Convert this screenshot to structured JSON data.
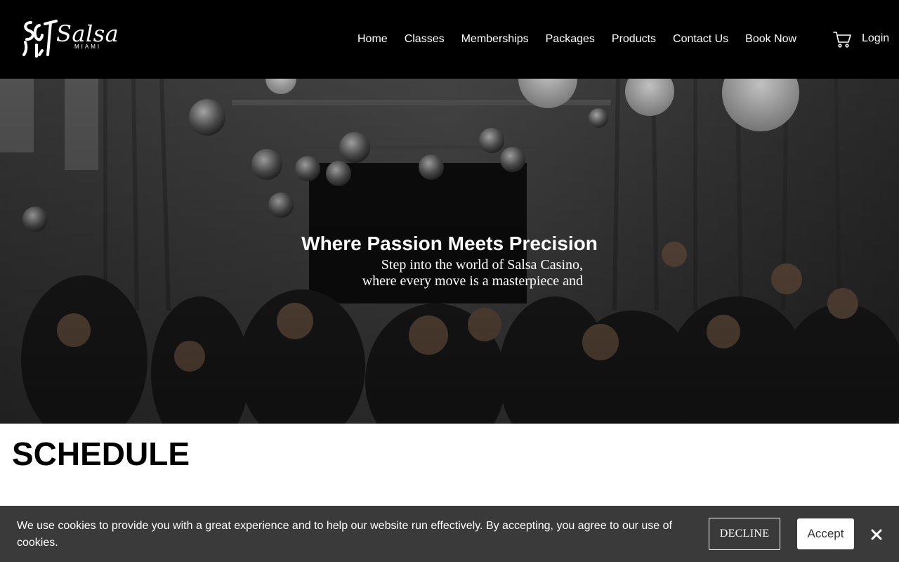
{
  "logo": {
    "mark_alt": "SCT",
    "word": "Salsa",
    "sub": "MIAMI"
  },
  "nav": {
    "items": [
      {
        "label": "Home"
      },
      {
        "label": "Classes"
      },
      {
        "label": "Memberships"
      },
      {
        "label": "Packages"
      },
      {
        "label": "Products"
      },
      {
        "label": "Contact Us"
      },
      {
        "label": "Book Now"
      }
    ],
    "cart_icon": "cart-icon",
    "login_label": "Login"
  },
  "hero": {
    "title": "Where Passion Meets Precision",
    "subtitle_line1": "Step into the world of Salsa Casino,",
    "subtitle_line2": "where every move is a masterpiece and"
  },
  "schedule": {
    "title": "SCHEDULE"
  },
  "cookie": {
    "text": "We use cookies to provide you with a great experience and to help our website run effectively. By accepting, you agree to our use of cookies.",
    "decline_label": "DECLINE",
    "accept_label": "Accept",
    "close_icon": "close-icon"
  },
  "colors": {
    "header_bg": "#000000",
    "cookie_bg": "#3a3a3a",
    "text_light": "#ffffff"
  }
}
